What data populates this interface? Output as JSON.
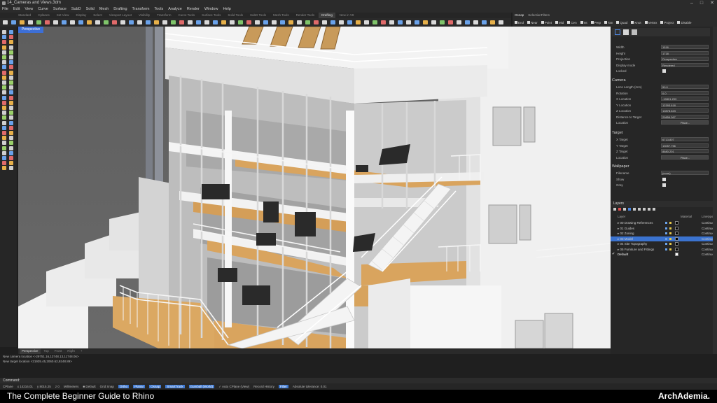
{
  "window": {
    "title": "14_Cameras and Views.3dm",
    "controls": [
      "–",
      "□",
      "✕"
    ]
  },
  "menu": [
    "File",
    "Edit",
    "View",
    "Curve",
    "Surface",
    "SubD",
    "Solid",
    "Mesh",
    "Drafting",
    "Transform",
    "Tools",
    "Analyze",
    "Render",
    "Window",
    "Help"
  ],
  "toolbar_tabs": [
    {
      "label": "Standard",
      "active": false
    },
    {
      "label": "Cplanes",
      "active": false
    },
    {
      "label": "Set View",
      "active": false
    },
    {
      "label": "Display",
      "active": false
    },
    {
      "label": "Select",
      "active": false
    },
    {
      "label": "Viewport Layout",
      "active": false
    },
    {
      "label": "Visibility",
      "active": false
    },
    {
      "label": "Transform",
      "active": false
    },
    {
      "label": "Curve Tools",
      "active": false
    },
    {
      "label": "Surface Tools",
      "active": false
    },
    {
      "label": "Solid Tools",
      "active": false
    },
    {
      "label": "SubD Tools",
      "active": false
    },
    {
      "label": "Mesh Tools",
      "active": false
    },
    {
      "label": "Render Tools",
      "active": false
    },
    {
      "label": "Drafting",
      "active": true
    },
    {
      "label": "New in V8",
      "active": false
    }
  ],
  "osnap": {
    "tabs": [
      {
        "label": "Osnap",
        "active": true
      },
      {
        "label": "SelectionFilters",
        "active": false
      }
    ],
    "snaps": [
      "End",
      "Near",
      "Point",
      "Mid",
      "Cen",
      "Int",
      "Perp",
      "Tan",
      "Quad",
      "Knot",
      "Vertex",
      "Project",
      "Disable"
    ]
  },
  "viewport": {
    "name": "Perspective",
    "tabs": [
      {
        "label": "Perspective",
        "active": true
      },
      {
        "label": "Top",
        "active": false
      },
      {
        "label": "Front",
        "active": false
      },
      {
        "label": "Right",
        "active": false
      },
      {
        "label": "+",
        "active": false
      }
    ]
  },
  "properties": {
    "rows_top": [
      {
        "label": "Width",
        "value": "1516"
      },
      {
        "label": "Height",
        "value": "1718"
      },
      {
        "label": "Projection",
        "value": "Perspective"
      },
      {
        "label": "Display mode",
        "value": "Rendered"
      },
      {
        "label": "Locked",
        "value": ""
      }
    ],
    "camera_title": "Camera",
    "camera_rows": [
      {
        "label": "Lens Length (mm)",
        "value": "50.0"
      },
      {
        "label": "Rotation",
        "value": "0.0"
      },
      {
        "label": "X Location",
        "value": "-19801.293"
      },
      {
        "label": "Y Location",
        "value": "12393.618"
      },
      {
        "label": "Z Location",
        "value": "10878.623"
      },
      {
        "label": "Distance to Target",
        "value": "29856.367"
      },
      {
        "label": "Location",
        "value": "Place..."
      }
    ],
    "target_title": "Target",
    "target_rows": [
      {
        "label": "X Target",
        "value": "6713.807"
      },
      {
        "label": "Y Target",
        "value": "13057.756"
      },
      {
        "label": "Z Target",
        "value": "8680.201"
      },
      {
        "label": "Location",
        "value": "Place..."
      }
    ],
    "wallpaper_title": "Wallpaper",
    "wallpaper_rows": [
      {
        "label": "Filename",
        "value": "(none)"
      },
      {
        "label": "Show",
        "value": ""
      },
      {
        "label": "Gray",
        "value": ""
      }
    ]
  },
  "layers": {
    "title": "Layers",
    "columns": [
      "Layer",
      "Material",
      "Linetype"
    ],
    "rows": [
      {
        "name": "▸ 00 Drawing References",
        "color": "#000000",
        "linetype": "Continuous",
        "selected": false
      },
      {
        "name": "▸ 01 Guides",
        "color": "#000000",
        "linetype": "Continuous",
        "selected": false
      },
      {
        "name": "▸ 02 Zoning",
        "color": "#000000",
        "linetype": "Continuous",
        "selected": false
      },
      {
        "name": "▸ 03 Model",
        "color": "#000000",
        "linetype": "Continuous",
        "selected": true
      },
      {
        "name": "▸ 04 Site Topography",
        "color": "#000000",
        "linetype": "Continuous",
        "selected": false
      },
      {
        "name": "▸ 05 Furniture and Fittings",
        "color": "#000000",
        "linetype": "Continuous",
        "selected": false
      },
      {
        "name": "Default",
        "color": "#ffffff",
        "linetype": "Continuous",
        "selected": false,
        "current": true
      }
    ]
  },
  "history": [
    "New camera location <-29751.16,13748.13,11748.06>",
    "New target location <21935.45,2060.62,9248.89>"
  ],
  "command": {
    "label": "Command:"
  },
  "status": [
    {
      "text": "CPlane",
      "on": false
    },
    {
      "text": "x 14216.01",
      "on": false
    },
    {
      "text": "y 8015.25",
      "on": false
    },
    {
      "text": "z 0",
      "on": false
    },
    {
      "text": "Millimeters",
      "on": false
    },
    {
      "text": "■ Default",
      "on": false
    },
    {
      "text": "Grid Snap",
      "on": false
    },
    {
      "text": "Ortho",
      "on": true
    },
    {
      "text": "Planar",
      "on": true
    },
    {
      "text": "Osnap",
      "on": true
    },
    {
      "text": "SmartTrack",
      "on": true
    },
    {
      "text": "Gumball (World)",
      "on": true
    },
    {
      "text": "✓ Auto CPlane (View)",
      "on": false
    },
    {
      "text": "Record History",
      "on": false
    },
    {
      "text": "Filter",
      "on": true
    },
    {
      "text": "Absolute tolerance: 0.01",
      "on": false
    }
  ],
  "caption": {
    "title": "The Complete Beginner Guide to Rhino",
    "brand": "ArchAdemia."
  }
}
